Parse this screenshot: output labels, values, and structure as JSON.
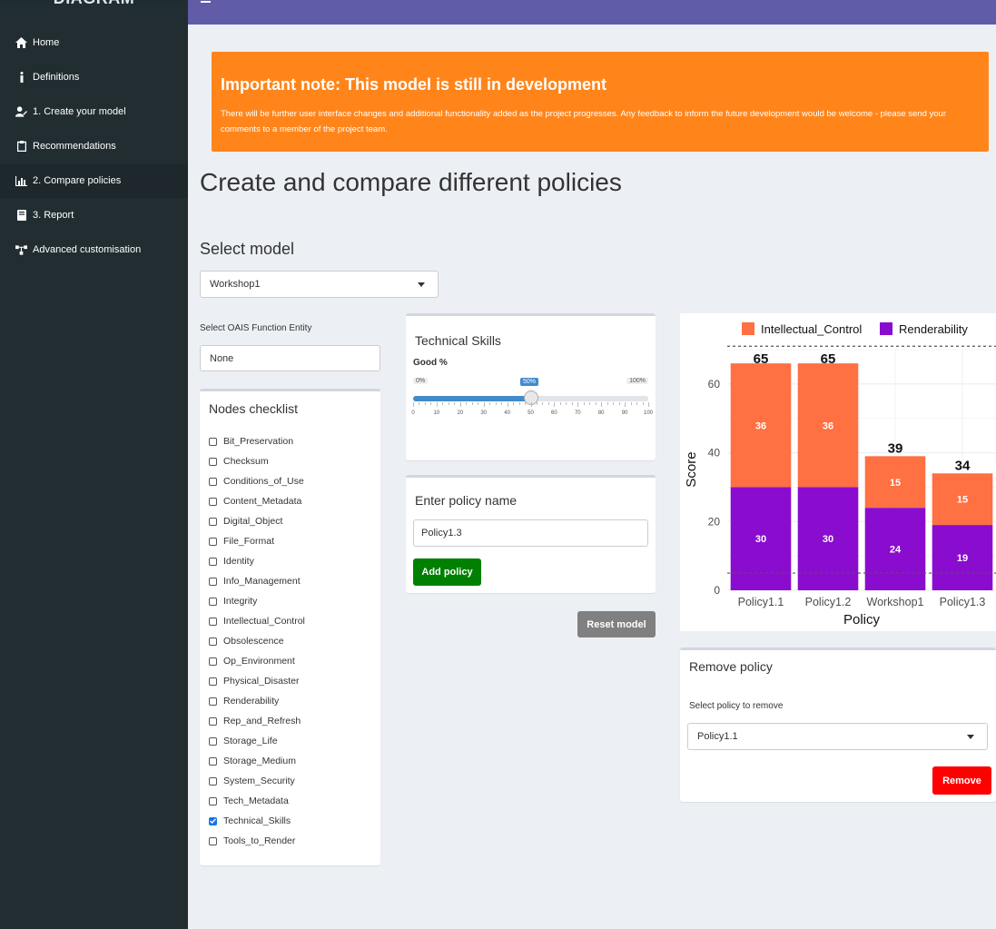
{
  "app": {
    "brand": "DIAGRAM"
  },
  "sidebar": {
    "items": [
      {
        "label": "Home",
        "icon": "home-icon"
      },
      {
        "label": "Definitions",
        "icon": "info-icon"
      },
      {
        "label": "1. Create your model",
        "icon": "user-edit-icon"
      },
      {
        "label": "Recommendations",
        "icon": "clipboard-icon"
      },
      {
        "label": "2. Compare policies",
        "icon": "bar-chart-icon",
        "active": true
      },
      {
        "label": "3. Report",
        "icon": "book-icon"
      },
      {
        "label": "Advanced customisation",
        "icon": "network-icon"
      }
    ]
  },
  "note": {
    "title": "Important note: This model is still in development",
    "body": "There will be further user interface changes and additional functionality added as the project progresses. Any feedback to inform the future development would be welcome - please send your comments to a member of the project team."
  },
  "page": {
    "title": "Create and compare different policies"
  },
  "select_model": {
    "label": "Select model",
    "value": "Workshop1"
  },
  "oais": {
    "label": "Select OAIS Function Entity",
    "value": "None"
  },
  "checklist": {
    "title": "Nodes checklist",
    "items": [
      {
        "label": "Bit_Preservation",
        "checked": false
      },
      {
        "label": "Checksum",
        "checked": false
      },
      {
        "label": "Conditions_of_Use",
        "checked": false
      },
      {
        "label": "Content_Metadata",
        "checked": false
      },
      {
        "label": "Digital_Object",
        "checked": false
      },
      {
        "label": "File_Format",
        "checked": false
      },
      {
        "label": "Identity",
        "checked": false
      },
      {
        "label": "Info_Management",
        "checked": false
      },
      {
        "label": "Integrity",
        "checked": false
      },
      {
        "label": "Intellectual_Control",
        "checked": false
      },
      {
        "label": "Obsolescence",
        "checked": false
      },
      {
        "label": "Op_Environment",
        "checked": false
      },
      {
        "label": "Physical_Disaster",
        "checked": false
      },
      {
        "label": "Renderability",
        "checked": false
      },
      {
        "label": "Rep_and_Refresh",
        "checked": false
      },
      {
        "label": "Storage_Life",
        "checked": false
      },
      {
        "label": "Storage_Medium",
        "checked": false
      },
      {
        "label": "System_Security",
        "checked": false
      },
      {
        "label": "Tech_Metadata",
        "checked": false
      },
      {
        "label": "Technical_Skills",
        "checked": true
      },
      {
        "label": "Tools_to_Render",
        "checked": false
      }
    ]
  },
  "skills": {
    "title": "Technical Skills",
    "slider_label": "Good %",
    "min_label": "0%",
    "max_label": "100%",
    "value": 50,
    "value_label": "50%",
    "ticks": [
      "0",
      "10",
      "20",
      "30",
      "40",
      "50",
      "60",
      "70",
      "80",
      "90",
      "100"
    ]
  },
  "policy": {
    "label": "Enter policy name",
    "value": "Policy1.3",
    "add_label": "Add policy",
    "reset_label": "Reset model"
  },
  "remove": {
    "title": "Remove policy",
    "label": "Select policy to remove",
    "value": "Policy1.1",
    "button_label": "Remove"
  },
  "colors": {
    "header": "#605ca8",
    "sidebar": "#222d32",
    "note": "#ff851b",
    "add": "#008000",
    "reset": "#808080",
    "remove": "#ff0000"
  },
  "chart_data": {
    "type": "bar",
    "stacked": true,
    "categories": [
      "Policy1.1",
      "Policy1.2",
      "Workshop1",
      "Policy1.3"
    ],
    "series": [
      {
        "name": "Intellectual_Control",
        "color": "#ff7043",
        "values": [
          36,
          36,
          15,
          15
        ]
      },
      {
        "name": "Renderability",
        "color": "#8a0ccf",
        "values": [
          30,
          30,
          24,
          19
        ]
      }
    ],
    "totals": [
      65,
      65,
      39,
      34
    ],
    "xlabel": "Policy",
    "ylabel": "Score",
    "yticks": [
      "0",
      "20",
      "40",
      "60"
    ],
    "ylim": [
      0,
      70
    ],
    "reference_lines": [
      5,
      71
    ],
    "legend_position": "top",
    "grid": true
  }
}
